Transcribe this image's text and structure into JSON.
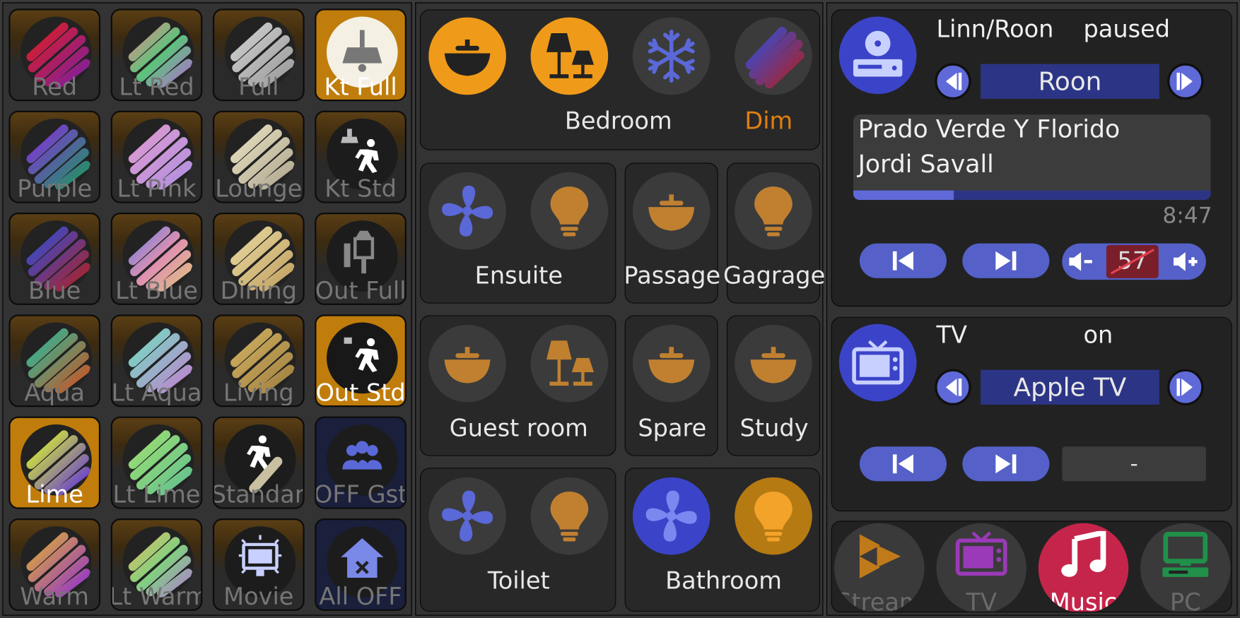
{
  "scenes": [
    {
      "label": "Red",
      "colors": [
        "#e01e1e",
        "#7a1fa3"
      ],
      "style": "brown"
    },
    {
      "label": "Lt Red",
      "colors": [
        "#e58a8a",
        "#5ac47a",
        "#b070d0"
      ],
      "style": "brown"
    },
    {
      "label": "Full",
      "colors": [
        "#d0d0d0",
        "#9a9a9a"
      ],
      "style": "brown"
    },
    {
      "label": "Kt Full",
      "icon": "kitchen-light",
      "style": "on"
    },
    {
      "label": "Purple",
      "colors": [
        "#8a2be2",
        "#1a9a5a"
      ],
      "style": "brown"
    },
    {
      "label": "Lt Pink",
      "colors": [
        "#e09ad0",
        "#b090e0"
      ],
      "style": "brown"
    },
    {
      "label": "Lounge",
      "colors": [
        "#e8e0c0",
        "#b0a890"
      ],
      "style": "brown"
    },
    {
      "label": "Kt Std",
      "icon": "kitchen-walk",
      "style": "brown"
    },
    {
      "label": "Blue",
      "colors": [
        "#2a50e0",
        "#b02020"
      ],
      "style": "brown"
    },
    {
      "label": "Lt Blue",
      "colors": [
        "#7080e0",
        "#e090b0",
        "#e0c080"
      ],
      "style": "brown"
    },
    {
      "label": "Dining",
      "colors": [
        "#e8d8a0",
        "#c0a060"
      ],
      "style": "brown"
    },
    {
      "label": "Out Full",
      "icon": "outdoor-lamp",
      "style": "brown"
    },
    {
      "label": "Aqua",
      "colors": [
        "#20c0a0",
        "#d05020"
      ],
      "style": "brown"
    },
    {
      "label": "Lt Aqua",
      "colors": [
        "#70e0c0",
        "#c080d0"
      ],
      "style": "brown"
    },
    {
      "label": "Living",
      "colors": [
        "#d0b060",
        "#a08040"
      ],
      "style": "brown"
    },
    {
      "label": "Out Std",
      "icon": "outdoor-walk",
      "style": "on"
    },
    {
      "label": "Lime",
      "colors": [
        "#e0ff20",
        "#6030e0"
      ],
      "style": "on"
    },
    {
      "label": "Lt Lime",
      "colors": [
        "#a0e070",
        "#60c090"
      ],
      "style": "brown"
    },
    {
      "label": "Standard",
      "icon": "walk-split",
      "style": "brown"
    },
    {
      "label": "OFF Gst",
      "icon": "group-off",
      "style": "blue"
    },
    {
      "label": "Warm",
      "colors": [
        "#e0b030",
        "#9030d0"
      ],
      "style": "brown"
    },
    {
      "label": "Lt Warm",
      "colors": [
        "#e0c060",
        "#80d080",
        "#b080d0"
      ],
      "style": "brown"
    },
    {
      "label": "Movie",
      "icon": "movie-screen",
      "style": "brown"
    },
    {
      "label": "All OFF",
      "icon": "house-off",
      "style": "blue"
    }
  ],
  "rooms": {
    "bedroom": {
      "label": "Bedroom",
      "state": "Dim"
    },
    "ensuite": {
      "label": "Ensuite"
    },
    "passage": {
      "label": "Passage"
    },
    "gagrage": {
      "label": "Gagrage"
    },
    "guest": {
      "label": "Guest room"
    },
    "spare": {
      "label": "Spare"
    },
    "study": {
      "label": "Study"
    },
    "toilet": {
      "label": "Toilet"
    },
    "bathroom": {
      "label": "Bathroom"
    }
  },
  "music": {
    "device": "Linn/Roon",
    "state": "paused",
    "source": "Roon",
    "track": "Prado Verde Y Florido",
    "artist": "Jordi Savall",
    "time": "8:47",
    "progress": 0.28,
    "volume": "57"
  },
  "tv": {
    "device": "TV",
    "state": "on",
    "source": "Apple TV",
    "volume": "-"
  },
  "modes": [
    {
      "label": "Stream",
      "icon": "stream-icon",
      "color": "#e09020"
    },
    {
      "label": "TV",
      "icon": "tv-icon",
      "color": "#a040c0"
    },
    {
      "label": "Music",
      "icon": "music-icon",
      "color": "#c5254a"
    },
    {
      "label": "PC",
      "icon": "pc-icon",
      "color": "#20a050"
    }
  ],
  "colors": {
    "accent_orange": "#f09a1a",
    "accent_blue": "#5560c8",
    "dim_text": "#e8800f",
    "active_red": "#c5254a"
  }
}
